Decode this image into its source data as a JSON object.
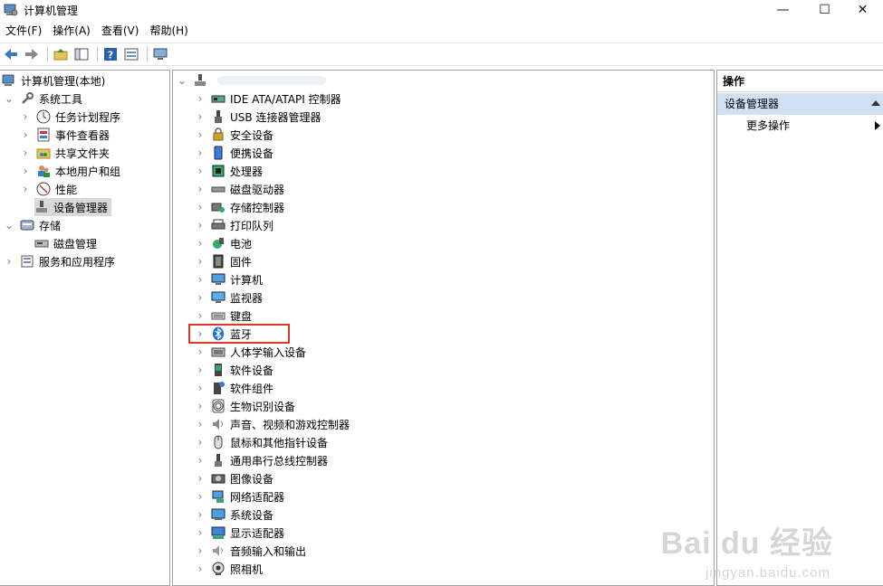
{
  "window": {
    "title": "计算机管理",
    "controls": {
      "minimize": "—",
      "maximize": "☐",
      "close": "✕"
    }
  },
  "menu": [
    "文件(F)",
    "操作(A)",
    "查看(V)",
    "帮助(H)"
  ],
  "left_tree": [
    {
      "label": "计算机管理(本地)",
      "icon": "computer-management-icon"
    },
    {
      "label": "系统工具",
      "icon": "system-tools-icon"
    },
    {
      "label": "任务计划程序",
      "icon": "task-scheduler-icon"
    },
    {
      "label": "事件查看器",
      "icon": "event-viewer-icon"
    },
    {
      "label": "共享文件夹",
      "icon": "shared-folders-icon"
    },
    {
      "label": "本地用户和组",
      "icon": "local-users-icon"
    },
    {
      "label": "性能",
      "icon": "performance-icon"
    },
    {
      "label": "设备管理器",
      "icon": "device-manager-icon"
    },
    {
      "label": "存储",
      "icon": "storage-icon"
    },
    {
      "label": "磁盘管理",
      "icon": "disk-management-icon"
    },
    {
      "label": "服务和应用程序",
      "icon": "services-apps-icon"
    }
  ],
  "device_tree": {
    "root_label": "",
    "categories": [
      {
        "label": "IDE ATA/ATAPI 控制器",
        "icon": "ide-controller-icon"
      },
      {
        "label": "USB 连接器管理器",
        "icon": "usb-icon"
      },
      {
        "label": "安全设备",
        "icon": "security-device-icon"
      },
      {
        "label": "便携设备",
        "icon": "portable-device-icon"
      },
      {
        "label": "处理器",
        "icon": "processor-icon"
      },
      {
        "label": "磁盘驱动器",
        "icon": "disk-drive-icon"
      },
      {
        "label": "存储控制器",
        "icon": "storage-controller-icon"
      },
      {
        "label": "打印队列",
        "icon": "printer-icon"
      },
      {
        "label": "电池",
        "icon": "battery-icon"
      },
      {
        "label": "固件",
        "icon": "firmware-icon"
      },
      {
        "label": "计算机",
        "icon": "computer-icon"
      },
      {
        "label": "监视器",
        "icon": "monitor-icon"
      },
      {
        "label": "键盘",
        "icon": "keyboard-icon"
      },
      {
        "label": "蓝牙",
        "icon": "bluetooth-icon"
      },
      {
        "label": "人体学输入设备",
        "icon": "hid-icon"
      },
      {
        "label": "软件设备",
        "icon": "software-device-icon"
      },
      {
        "label": "软件组件",
        "icon": "software-component-icon"
      },
      {
        "label": "生物识别设备",
        "icon": "biometric-icon"
      },
      {
        "label": "声音、视频和游戏控制器",
        "icon": "sound-icon"
      },
      {
        "label": "鼠标和其他指针设备",
        "icon": "mouse-icon"
      },
      {
        "label": "通用串行总线控制器",
        "icon": "usb-controller-icon"
      },
      {
        "label": "图像设备",
        "icon": "imaging-device-icon"
      },
      {
        "label": "网络适配器",
        "icon": "network-adapter-icon"
      },
      {
        "label": "系统设备",
        "icon": "system-device-icon"
      },
      {
        "label": "显示适配器",
        "icon": "display-adapter-icon"
      },
      {
        "label": "音频输入和输出",
        "icon": "audio-io-icon"
      },
      {
        "label": "照相机",
        "icon": "camera-icon"
      }
    ]
  },
  "actions": {
    "header": "操作",
    "section": "设备管理器",
    "item": "更多操作"
  },
  "watermark": {
    "main": "Bai du 经验",
    "sub": "jingyan.baidu.com"
  },
  "colors": {
    "selection": "#d9d9d9",
    "highlight": "#e0352b",
    "section_bg": "#cfe0f3"
  }
}
